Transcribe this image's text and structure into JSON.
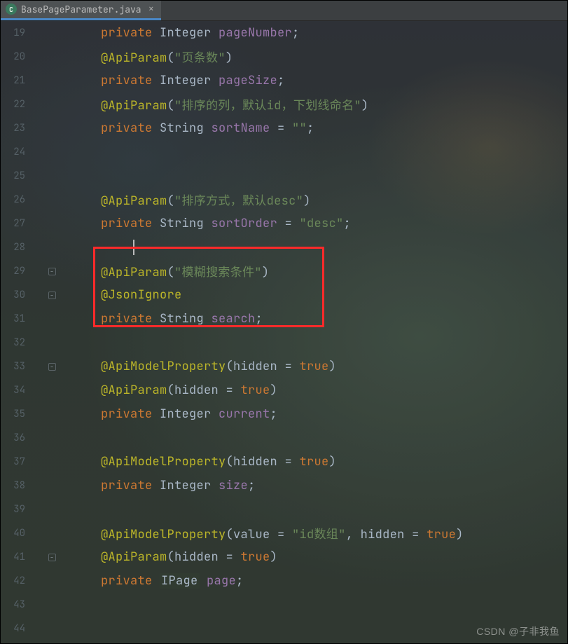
{
  "tab": {
    "filename": "BasePageParameter.java",
    "icon_letter": "C"
  },
  "watermark": "CSDN @子非我鱼",
  "gutter": {
    "start": 19,
    "end": 44
  },
  "fold_markers": {
    "29": true,
    "30": true,
    "33": true,
    "41": true
  },
  "code_lines": {
    "19": [
      {
        "cls": "kw",
        "t": "private"
      },
      {
        "cls": "pun",
        "t": " "
      },
      {
        "cls": "type",
        "t": "Integer"
      },
      {
        "cls": "pun",
        "t": " "
      },
      {
        "cls": "var",
        "t": "pageNumber"
      },
      {
        "cls": "pun",
        "t": ";"
      }
    ],
    "20": [
      {
        "cls": "ann",
        "t": "@ApiParam"
      },
      {
        "cls": "pun",
        "t": "("
      },
      {
        "cls": "str",
        "t": "\"页条数\""
      },
      {
        "cls": "pun",
        "t": ")"
      }
    ],
    "21": [
      {
        "cls": "kw",
        "t": "private"
      },
      {
        "cls": "pun",
        "t": " "
      },
      {
        "cls": "type",
        "t": "Integer"
      },
      {
        "cls": "pun",
        "t": " "
      },
      {
        "cls": "var",
        "t": "pageSize"
      },
      {
        "cls": "pun",
        "t": ";"
      }
    ],
    "22": [
      {
        "cls": "ann",
        "t": "@ApiParam"
      },
      {
        "cls": "pun",
        "t": "("
      },
      {
        "cls": "str",
        "t": "\"排序的列，默认id，下划线命名\""
      },
      {
        "cls": "pun",
        "t": ")"
      }
    ],
    "23": [
      {
        "cls": "kw",
        "t": "private"
      },
      {
        "cls": "pun",
        "t": " "
      },
      {
        "cls": "type",
        "t": "String"
      },
      {
        "cls": "pun",
        "t": " "
      },
      {
        "cls": "var",
        "t": "sortName"
      },
      {
        "cls": "pun",
        "t": " = "
      },
      {
        "cls": "str",
        "t": "\"\""
      },
      {
        "cls": "pun",
        "t": ";"
      }
    ],
    "24": [],
    "25": [],
    "26": [
      {
        "cls": "ann",
        "t": "@ApiParam"
      },
      {
        "cls": "pun",
        "t": "("
      },
      {
        "cls": "str",
        "t": "\"排序方式，默认desc\""
      },
      {
        "cls": "pun",
        "t": ")"
      }
    ],
    "27": [
      {
        "cls": "kw",
        "t": "private"
      },
      {
        "cls": "pun",
        "t": " "
      },
      {
        "cls": "type",
        "t": "String"
      },
      {
        "cls": "pun",
        "t": " "
      },
      {
        "cls": "var",
        "t": "sortOrder"
      },
      {
        "cls": "pun",
        "t": " = "
      },
      {
        "cls": "str",
        "t": "\"desc\""
      },
      {
        "cls": "pun",
        "t": ";"
      }
    ],
    "28": [],
    "29": [
      {
        "cls": "ann",
        "t": "@ApiParam"
      },
      {
        "cls": "pun",
        "t": "("
      },
      {
        "cls": "str",
        "t": "\"模糊搜索条件\""
      },
      {
        "cls": "pun",
        "t": ")"
      }
    ],
    "30": [
      {
        "cls": "ann",
        "t": "@JsonIgnore"
      }
    ],
    "31": [
      {
        "cls": "kw",
        "t": "private"
      },
      {
        "cls": "pun",
        "t": " "
      },
      {
        "cls": "type",
        "t": "String"
      },
      {
        "cls": "pun",
        "t": " "
      },
      {
        "cls": "var",
        "t": "search"
      },
      {
        "cls": "pun",
        "t": ";"
      }
    ],
    "32": [],
    "33": [
      {
        "cls": "ann",
        "t": "@ApiModelProperty"
      },
      {
        "cls": "pun",
        "t": "(hidden = "
      },
      {
        "cls": "kw",
        "t": "true"
      },
      {
        "cls": "pun",
        "t": ")"
      }
    ],
    "34": [
      {
        "cls": "ann",
        "t": "@ApiParam"
      },
      {
        "cls": "pun",
        "t": "(hidden = "
      },
      {
        "cls": "kw",
        "t": "true"
      },
      {
        "cls": "pun",
        "t": ")"
      }
    ],
    "35": [
      {
        "cls": "kw",
        "t": "private"
      },
      {
        "cls": "pun",
        "t": " "
      },
      {
        "cls": "type",
        "t": "Integer"
      },
      {
        "cls": "pun",
        "t": " "
      },
      {
        "cls": "var",
        "t": "current"
      },
      {
        "cls": "pun",
        "t": ";"
      }
    ],
    "36": [],
    "37": [
      {
        "cls": "ann",
        "t": "@ApiModelProperty"
      },
      {
        "cls": "pun",
        "t": "(hidden = "
      },
      {
        "cls": "kw",
        "t": "true"
      },
      {
        "cls": "pun",
        "t": ")"
      }
    ],
    "38": [
      {
        "cls": "kw",
        "t": "private"
      },
      {
        "cls": "pun",
        "t": " "
      },
      {
        "cls": "type",
        "t": "Integer"
      },
      {
        "cls": "pun",
        "t": " "
      },
      {
        "cls": "var",
        "t": "size"
      },
      {
        "cls": "pun",
        "t": ";"
      }
    ],
    "39": [],
    "40": [
      {
        "cls": "ann",
        "t": "@ApiModelProperty"
      },
      {
        "cls": "pun",
        "t": "(value = "
      },
      {
        "cls": "str",
        "t": "\"id数组\""
      },
      {
        "cls": "pun",
        "t": ", hidden = "
      },
      {
        "cls": "kw",
        "t": "true"
      },
      {
        "cls": "pun",
        "t": ")"
      }
    ],
    "41": [
      {
        "cls": "ann",
        "t": "@ApiParam"
      },
      {
        "cls": "pun",
        "t": "(hidden = "
      },
      {
        "cls": "kw",
        "t": "true"
      },
      {
        "cls": "pun",
        "t": ")"
      }
    ],
    "42": [
      {
        "cls": "kw",
        "t": "private"
      },
      {
        "cls": "pun",
        "t": " "
      },
      {
        "cls": "type hlbg",
        "t": "IPage"
      },
      {
        "cls": "pun",
        "t": " "
      },
      {
        "cls": "var",
        "t": "page"
      },
      {
        "cls": "pun",
        "t": ";"
      }
    ],
    "43": [],
    "44": []
  }
}
